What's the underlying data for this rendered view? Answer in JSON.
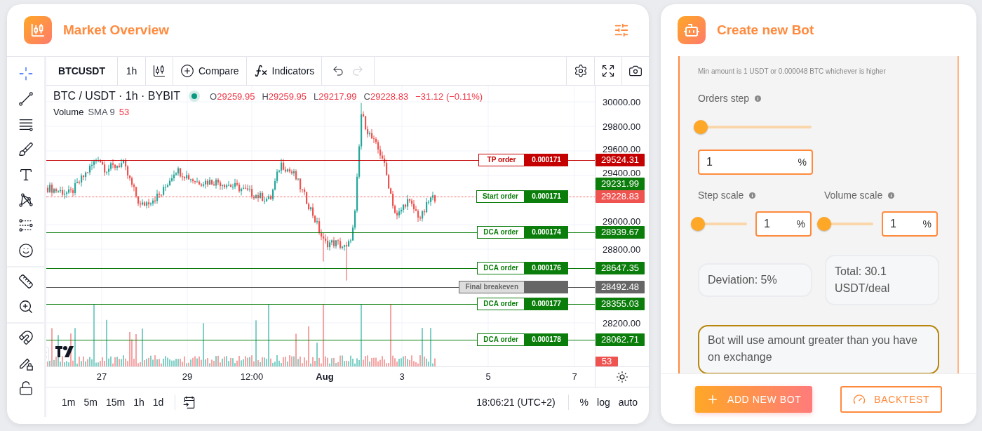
{
  "market": {
    "title": "Market Overview",
    "tool_groups": [
      [
        {
          "kind": "crosshair",
          "selected": true
        },
        {
          "kind": "trend-line",
          "selected": false
        },
        {
          "kind": "horizontal-lines",
          "selected": false
        },
        {
          "kind": "brush",
          "selected": false
        },
        {
          "kind": "text",
          "selected": false
        },
        {
          "kind": "pattern",
          "selected": false
        },
        {
          "kind": "fib",
          "selected": false
        },
        {
          "kind": "emoji",
          "selected": false
        }
      ],
      [
        {
          "kind": "ruler",
          "selected": false
        },
        {
          "kind": "zoom",
          "selected": false
        }
      ],
      [
        {
          "kind": "magnet",
          "selected": false
        },
        {
          "kind": "pencil-lock",
          "selected": false
        },
        {
          "kind": "lock",
          "selected": false
        }
      ]
    ],
    "symbol": "BTCUSDT",
    "interval": "1h",
    "compare": "Compare",
    "indicators": "Indicators",
    "undo": {
      "disabled": false
    },
    "redo": {
      "disabled": true
    },
    "legend": {
      "title": "BTC / USDT · 1h · BYBIT",
      "ohlc": [
        {
          "letter": "O",
          "value": "29259.95"
        },
        {
          "letter": "H",
          "value": "29259.95"
        },
        {
          "letter": "L",
          "value": "29217.99"
        },
        {
          "letter": "C",
          "value": "29228.83"
        }
      ],
      "change": "−31.12 (−0.11%)",
      "volume_label": "Volume",
      "volume_indicator": "SMA 9",
      "volume_value": "53"
    },
    "price_ticks": [
      "30000.00",
      "29800.00",
      "29600.00",
      "29400.00",
      "29000.00",
      "28800.00",
      "28200.00"
    ],
    "orders": [
      {
        "kind": "tp",
        "label": "TP order",
        "amount": "0.000171",
        "price": "29524.31"
      },
      {
        "kind": "start",
        "label": "Start order",
        "amount": "0.000171",
        "price": "29231.99"
      },
      {
        "kind": "dca",
        "label": "DCA order",
        "amount": "0.000174",
        "price": "28939.67"
      },
      {
        "kind": "dca",
        "label": "DCA order",
        "amount": "0.000176",
        "price": "28647.35"
      },
      {
        "kind": "breakeven",
        "label": "Final breakeven",
        "price": "28492.48"
      },
      {
        "kind": "dca",
        "label": "DCA order",
        "amount": "0.000177",
        "price": "28355.03"
      },
      {
        "kind": "dca",
        "label": "DCA order",
        "amount": "0.000178",
        "price": "28062.71"
      }
    ],
    "last_price": "29228.83",
    "volume_tag": "53",
    "time_labels": [
      {
        "text": "27",
        "bold": false
      },
      {
        "text": "29",
        "bold": false
      },
      {
        "text": "12:00",
        "bold": false
      },
      {
        "text": "Aug",
        "bold": true
      },
      {
        "text": "3",
        "bold": false
      },
      {
        "text": "5",
        "bold": false
      },
      {
        "text": "7",
        "bold": false
      }
    ],
    "timeframes": [
      "1m",
      "5m",
      "15m",
      "1h",
      "1d"
    ],
    "clock": "18:06:21 (UTC+2)",
    "scale_options": [
      "%",
      "log",
      "auto"
    ]
  },
  "bot": {
    "title": "Create new Bot",
    "min_note": "Min amount is 1 USDT or 0.000048 BTC whichever is higher",
    "orders_step": {
      "label": "Orders step",
      "level": 0,
      "value": "1",
      "unit": "%"
    },
    "step_scale": {
      "label": "Step scale",
      "level": 0,
      "value": "1",
      "unit": "%"
    },
    "volume_scale": {
      "label": "Volume scale",
      "level": 0,
      "value": "1",
      "unit": "%"
    },
    "deviation": "Deviation: 5%",
    "total": "Total: 30.1 USDT/deal",
    "warning": "Bot will use amount greater than you have on exchange",
    "buttons": [
      {
        "kind": "primary",
        "label": "ADD NEW BOT"
      },
      {
        "kind": "outline",
        "label": "BACKTEST"
      }
    ]
  }
}
